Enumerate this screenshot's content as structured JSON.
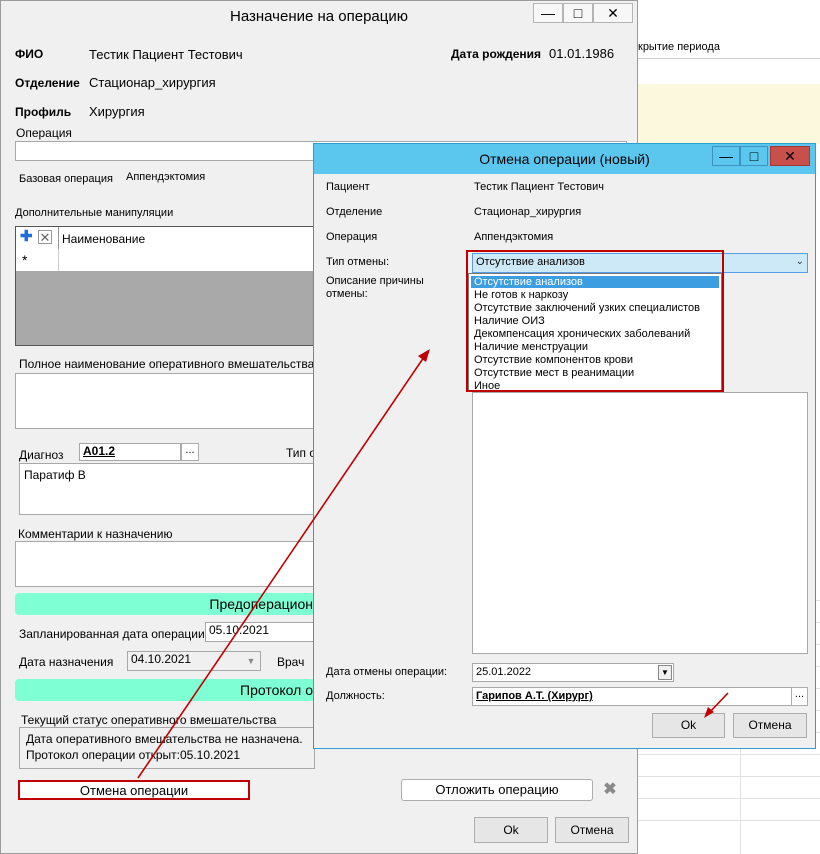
{
  "background": {
    "partial_heading": "крытие периода"
  },
  "main_window": {
    "title": "Назначение на операцию",
    "controls": {
      "minimize": "—",
      "maximize": "□",
      "close": "✕"
    },
    "fio_label": "ФИО",
    "fio_value": "Тестик Пациент Тестович",
    "dob_label": "Дата рождения",
    "dob_value": "01.01.1986",
    "department_label": "Отделение",
    "department_value": "Стационар_хирургия",
    "profile_label": "Профиль",
    "profile_value": "Хирургия",
    "operation_label": "Операция",
    "base_operation_label": "Базовая операция",
    "base_operation_value": "Аппендэктомия",
    "manipulations_label": "Дополнительные манипуляции",
    "manipulations_column": "Наименование",
    "manipulations_new_row_marker": "*",
    "full_name_label": "Полное наименование оперативного вмешательства",
    "diagnosis_label": "Диагноз",
    "diagnosis_code": "A01.2",
    "diagnosis_type_label": "Тип о",
    "diagnosis_text": "Паратиф В",
    "comments_label": "Комментарии к назначению",
    "preop_bar": "Предоперацион",
    "planned_date_label": "Запланированная дата операции",
    "planned_date_value": "05.10.2021",
    "assign_date_label": "Дата назначения",
    "assign_date_value": "04.10.2021",
    "doctor_label": "Врач",
    "protocol_bar": "Протокол о",
    "status_label": "Текущий статус оперативного вмешательства",
    "status_line1": "Дата оперативного вмешательства не назначена.",
    "status_line2": "Протокол операции открыт:05.10.2021",
    "cancel_operation_button": "Отмена операции",
    "postpone_operation_button": "Отложить операцию",
    "ok_button": "Ok",
    "cancel_button": "Отмена",
    "ellipsis": "..."
  },
  "dialog": {
    "title": "Отмена операции (новый)",
    "controls": {
      "minimize": "—",
      "maximize": "□",
      "close": "✕"
    },
    "patient_label": "Пациент",
    "patient_value": "Тестик Пациент Тестович",
    "department_label": "Отделение",
    "department_value": "Стационар_хирургия",
    "operation_label": "Операция",
    "operation_value": "Аппендэктомия",
    "cancel_type_label": "Тип отмены:",
    "cancel_type_selected": "Отсутствие анализов",
    "reason_label_line1": "Описание причины",
    "reason_label_line2": "отмены:",
    "cancel_type_options": [
      "Отсутствие анализов",
      "Не готов к наркозу",
      "Отсутствие заключений узких специалистов",
      "Наличие ОИЗ",
      "Декомпенсация хронических заболеваний",
      "Наличие менструации",
      "Отсутствие компонентов крови",
      "Отсутствие мест в реанимации",
      "Иное"
    ],
    "cancel_date_label": "Дата отмены операции:",
    "cancel_date_value": "25.01.2022",
    "position_label": "Должность:",
    "position_value": "Гарипов А.Т. (Хирург)",
    "ellipsis": "...",
    "ok_button": "Ok",
    "cancel_button": "Отмена"
  },
  "colors": {
    "dialog_title": "#5bc7ef",
    "highlight": "#c00000",
    "green_bar": "#7fffd4",
    "selection": "#3c9de0"
  }
}
